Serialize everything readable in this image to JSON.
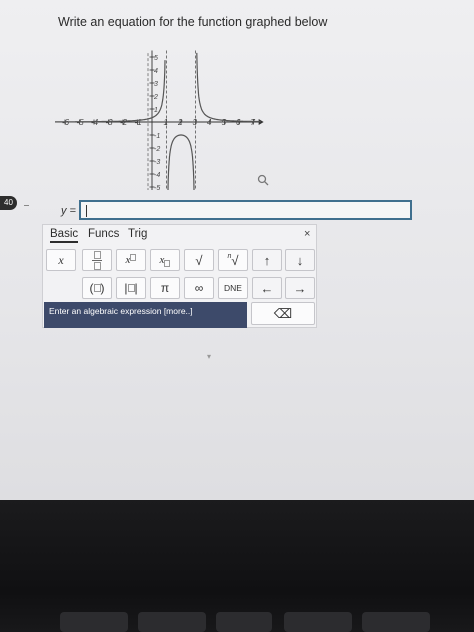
{
  "question": {
    "number": "40",
    "text": "Write an equation for the function graphed below"
  },
  "graph": {
    "x_ticks": [
      "-7",
      "-6",
      "-5",
      "-4",
      "-3",
      "-2",
      "-1",
      "1",
      "2",
      "3",
      "4",
      "5",
      "6",
      "7"
    ],
    "y_ticks": [
      "5",
      "4",
      "3",
      "2",
      "1",
      "-1",
      "-2",
      "-3",
      "-4",
      "-5"
    ],
    "asymptotes_x": [
      1,
      3
    ],
    "axis_color": "#333333",
    "curve_color": "#555555"
  },
  "answer": {
    "label": "y =",
    "value": ""
  },
  "keypad": {
    "tabs": [
      "Basic",
      "Funcs",
      "Trig"
    ],
    "close": "×",
    "row1": {
      "x": "x",
      "sqrt": "√",
      "nroot_index": "n",
      "nroot": "√",
      "up": "↑",
      "down": "↓"
    },
    "row2": {
      "paren_open": "(",
      "paren_close": ")",
      "abs": "|",
      "pi": "π",
      "infinity": "∞",
      "dne": "DNE",
      "left": "←",
      "right": "→"
    },
    "hint": "Enter an algebraic expression [more..]",
    "backspace": "⌫"
  }
}
